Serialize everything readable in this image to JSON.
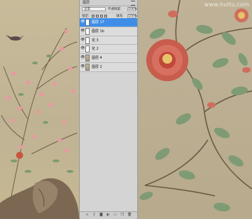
{
  "watermark": "www.huitu.com",
  "layers_panel": {
    "tab_label": "图层",
    "blend_mode": "正常",
    "opacity_label": "不透明度:",
    "opacity_value": "100%",
    "lock_label": "锁定:",
    "fill_label": "填充:",
    "fill_value": "100%",
    "layers": [
      {
        "name": "图层 17",
        "selected": true
      },
      {
        "name": "图层 1b",
        "selected": false
      },
      {
        "name": "花 3",
        "selected": false
      },
      {
        "name": "花 2",
        "selected": false
      },
      {
        "name": "图层 4",
        "selected": false
      },
      {
        "name": "图层 2",
        "selected": false
      }
    ],
    "footer_icons": [
      "link-icon",
      "fx-icon",
      "mask-icon",
      "adjustment-icon",
      "folder-icon",
      "new-layer-icon",
      "trash-icon"
    ]
  },
  "colors": {
    "selection": "#3e8ee8",
    "panel_bg": "#d6d6d6",
    "background_art": "#bfb297"
  }
}
